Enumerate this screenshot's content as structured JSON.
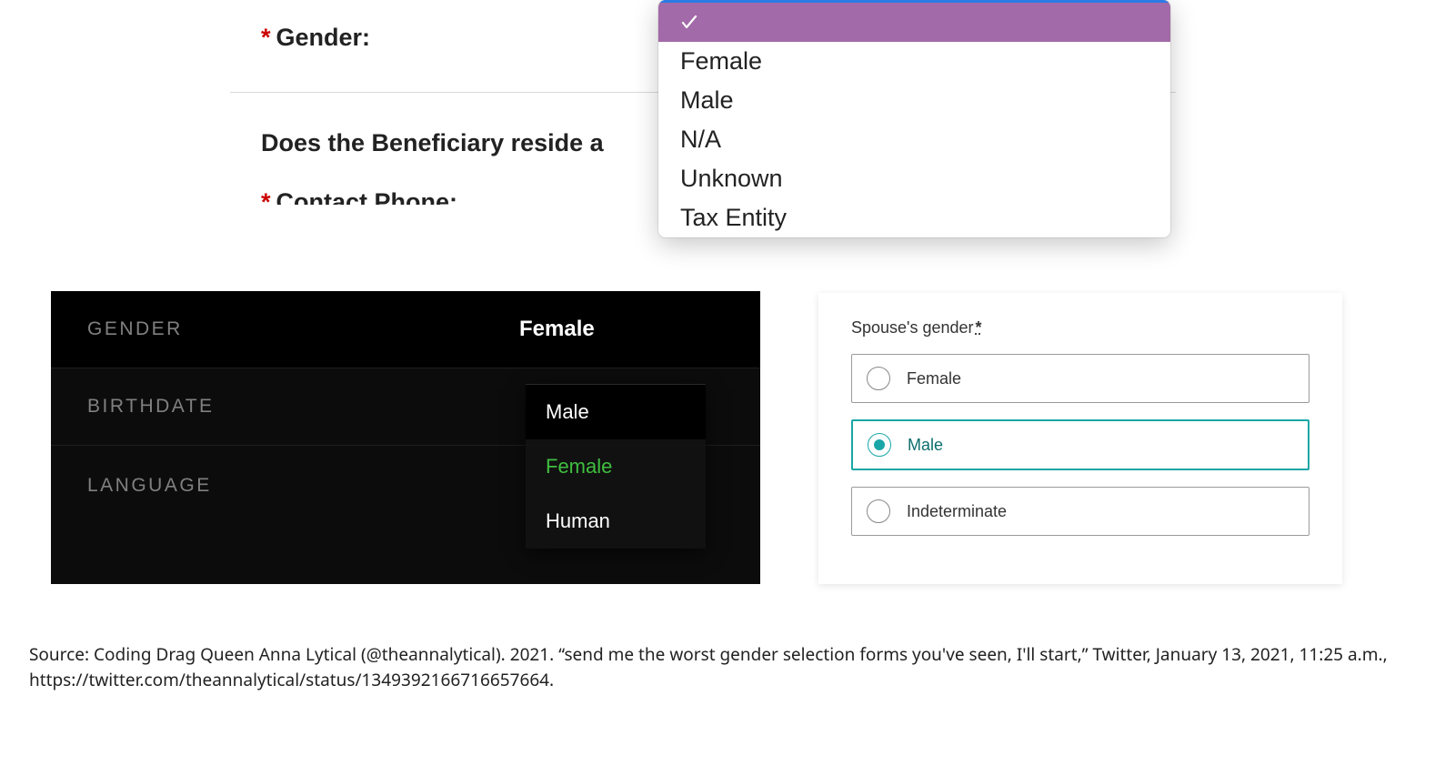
{
  "screenshot1": {
    "required_marker": "*",
    "gender_label": "Gender:",
    "beneficiary_question": "Does the Beneficiary reside a",
    "contact_label": "Contact Phone:",
    "dropdown_options": [
      "Female",
      "Male",
      "N/A",
      "Unknown",
      "Tax Entity"
    ]
  },
  "screenshot2": {
    "rows": [
      {
        "label": "GENDER",
        "value": "Female"
      },
      {
        "label": "BIRTHDATE",
        "value": ""
      },
      {
        "label": "LANGUAGE",
        "value": ""
      }
    ],
    "submenu": [
      "Male",
      "Female",
      "Human"
    ],
    "current": "Female"
  },
  "screenshot3": {
    "title": "Spouse's gender",
    "star": "*",
    "options": [
      "Female",
      "Male",
      "Indeterminate"
    ],
    "selected": "Male"
  },
  "caption": {
    "line1": "Source: Coding Drag Queen Anna Lytical (@theannalytical). 2021. “send me the worst gender selection forms you've seen, I'll start,” Twitter, January 13, 2021, 11:25 a.m., https://twitter.com/theannalytical/status/1349392166716657664."
  }
}
